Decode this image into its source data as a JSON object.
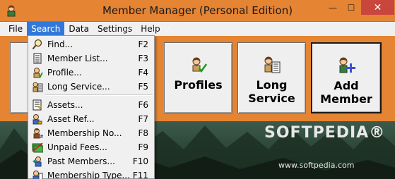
{
  "window": {
    "title": "Member Manager (Personal Edition)",
    "controls": {
      "minimize": "—",
      "maximize": "☐",
      "close": "✕"
    }
  },
  "menubar": {
    "items": [
      {
        "label": "File"
      },
      {
        "label": "Search"
      },
      {
        "label": "Data"
      },
      {
        "label": "Settings"
      },
      {
        "label": "Help"
      }
    ],
    "active": "Search"
  },
  "watermark": "SOFTPEDIA",
  "search_menu": {
    "items": [
      {
        "label": "Find...",
        "shortcut": "F2",
        "icon": "magnifier-icon"
      },
      {
        "label": "Member List...",
        "shortcut": "F3",
        "icon": "list-icon"
      },
      {
        "label": "Profile...",
        "shortcut": "F4",
        "icon": "profile-icon"
      },
      {
        "label": "Long Service...",
        "shortcut": "F5",
        "icon": "long-service-icon"
      },
      {
        "label": "Assets...",
        "shortcut": "F6",
        "icon": "assets-icon"
      },
      {
        "label": "Asset Ref...",
        "shortcut": "F7",
        "icon": "asset-ref-icon"
      },
      {
        "label": "Membership No...",
        "shortcut": "F8",
        "icon": "membership-no-icon"
      },
      {
        "label": "Unpaid Fees...",
        "shortcut": "F9",
        "icon": "unpaid-fees-icon"
      },
      {
        "label": "Past Members...",
        "shortcut": "F10",
        "icon": "past-members-icon"
      },
      {
        "label": "Membership Type...",
        "shortcut": "F11",
        "icon": "membership-type-icon"
      }
    ]
  },
  "toolbar_buttons": {
    "profiles": "Profiles",
    "long_service": "Long\nService",
    "add_member": "Add\nMember"
  },
  "branding": {
    "logo": "SOFTPEDIA®",
    "url": "www.softpedia.com"
  },
  "colors": {
    "titlebar": "#e58433",
    "menu_highlight": "#3378d8",
    "close_button": "#c8463c"
  }
}
